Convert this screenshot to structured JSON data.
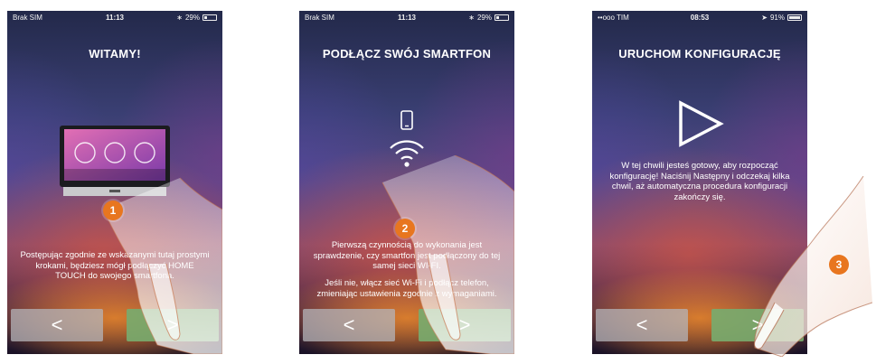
{
  "screens": [
    {
      "status": {
        "carrier": "Brak SIM",
        "time": "11:13",
        "battery": "29%"
      },
      "title": "WITAMY!",
      "body": "Postępując zgodnie ze wskazanymi tutaj prostymi krokami, będziesz mógł podłączyć HOME TOUCH do swojego smartfona.",
      "prev": "<",
      "next": ">",
      "step": "1"
    },
    {
      "status": {
        "carrier": "Brak SIM",
        "time": "11:13",
        "battery": "29%"
      },
      "title": "PODŁĄCZ SWÓJ SMARTFON",
      "body1": "Pierwszą czynnością do wykonania jest sprawdzenie, czy smartfon jest podłączony do tej samej sieci WI-FI.",
      "body2": "Jeśli nie, włącz sieć Wi-Fi i podłącz telefon, zmieniając ustawienia zgodnie z wymaganiami.",
      "prev": "<",
      "next": ">",
      "step": "2"
    },
    {
      "status": {
        "carrier": "••ooo TIM",
        "time": "08:53",
        "battery": "91%"
      },
      "title": "URUCHOM KONFIGURACJĘ",
      "body": "W tej chwili jesteś gotowy, aby rozpocząć konfigurację! Naciśnij Następny i odczekaj kilka chwil, aż automatyczna procedura konfiguracji zakończy się.",
      "prev": "<",
      "next": ">",
      "step": "3"
    }
  ],
  "colors": {
    "step_badge": "#e8761f",
    "next_button": "#78aa6e",
    "prev_button": "#b4b4b9"
  }
}
